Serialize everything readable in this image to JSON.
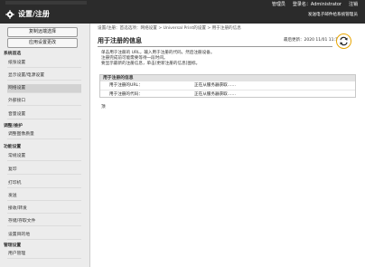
{
  "header": {
    "title": "设置/注册",
    "user_label": "管理员",
    "login_name_label": "登录名：Administrator",
    "logout_label": "注销",
    "mail_link": "发送电子邮件给系统管理员"
  },
  "sidebar": {
    "buttons": [
      "复制远端选择",
      "应用设置更改"
    ],
    "sections": [
      {
        "title": "系统首选",
        "items": [
          "纸张设置",
          "显示设置/电源设置",
          "网络设置",
          "外部接口",
          "音量设置"
        ]
      },
      {
        "title": "调整/维护",
        "items": [
          "调整图像质量"
        ]
      },
      {
        "title": "功能设置",
        "items": [
          "常规设置",
          "复印",
          "打印机",
          "发送",
          "接收/转发",
          "存储/存取文件"
        ]
      },
      {
        "title": "",
        "items": [
          "设置目的地"
        ]
      },
      {
        "title": "管理设置",
        "items": [
          "用户管理"
        ]
      }
    ],
    "active_item": "网络设置"
  },
  "main": {
    "breadcrumb": "设置/注册：首选选项：网络设置 > Universal Print的设置 > 用于注册的信息",
    "title": "用于注册的信息",
    "last_updated": "最后更新：2020 11/01 11:12:13",
    "description": [
      "单击用于注册的 URL，输入用于注册的代码，然后注册设备。",
      "注册完成前可能需要等待一段时间。",
      "要显示最新的注册信息，单击[更新注册的信息]图标。"
    ],
    "info_box": {
      "header": "用于注册的信息",
      "rows": [
        {
          "label": "用于注册的URL：",
          "value": "正在从服务器获取……"
        },
        {
          "label": "用于注册的代码：",
          "value": "正在从服务器获取……"
        }
      ]
    },
    "top_link": "顶"
  }
}
